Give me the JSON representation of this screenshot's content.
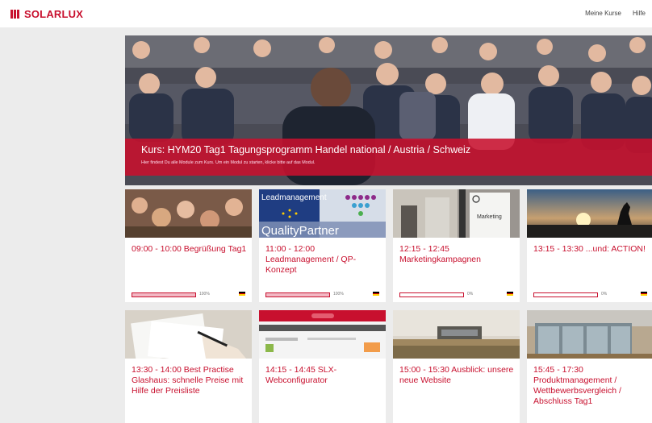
{
  "brand": {
    "name": "SOLARLUX",
    "color": "#c8102e"
  },
  "nav": {
    "my_courses": "Meine Kurse",
    "help": "Hilfe"
  },
  "hero": {
    "title": "Kurs: HYM20 Tag1 Tagungsprogramm Handel national / Austria / Schweiz",
    "subtitle": "Hier findest Du alle Module zum Kurs. Um ein Modul zu starten, klicke bitte auf das Modul."
  },
  "thumbnail_text": {
    "leadmanagement": "Leadmanagement",
    "qualitypartner": "QualityPartner",
    "marketing": "Marketing"
  },
  "modules": [
    {
      "title": "09:00 - 10:00 Begrüßung Tag1",
      "progress": 100,
      "progress_label": "100%",
      "image": "group-photo"
    },
    {
      "title": "11:00 - 12:00 Leadmanagement / QP-Konzept",
      "progress": 100,
      "progress_label": "100%",
      "image": "leadmanagement"
    },
    {
      "title": "12:15 - 12:45 Marketingkampagnen",
      "progress": 0,
      "progress_label": "0%",
      "image": "marketing"
    },
    {
      "title": "13:15 - 13:30 ...und: ACTION!",
      "progress": 0,
      "progress_label": "0%",
      "image": "sunset-silhouette"
    },
    {
      "title": "13:30 - 14:00 Best Practise Glashaus: schnelle Preise mit Hilfe der Preisliste",
      "progress": null,
      "progress_label": "",
      "image": "document-writing"
    },
    {
      "title": "14:15 - 14:45 SLX-Webconfigurator",
      "progress": null,
      "progress_label": "",
      "image": "web-configurator"
    },
    {
      "title": "15:00 - 15:30 Ausblick: unsere neue Website",
      "progress": null,
      "progress_label": "",
      "image": "building-landscape"
    },
    {
      "title": "15:45 - 17:30 Produktmanagement / Wettbewerbsvergleich / Abschluss Tag1",
      "progress": null,
      "progress_label": "",
      "image": "glass-house"
    }
  ]
}
